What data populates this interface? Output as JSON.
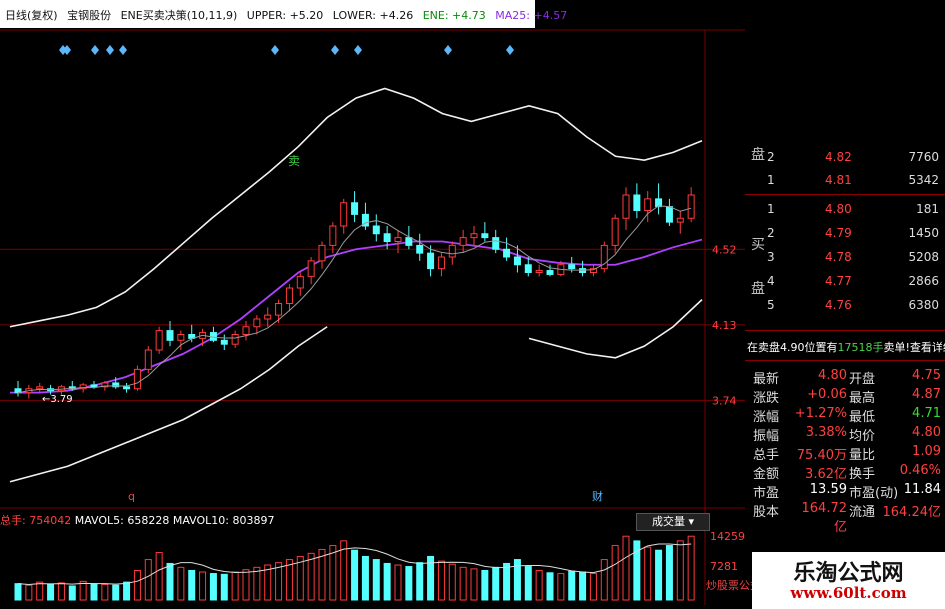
{
  "header": {
    "period": "日线(复权)",
    "stock_name": "宝钢股份",
    "indicator": "ENE买卖决策(10,11,9)",
    "upper": "UPPER: +5.20",
    "lower": "LOWER: +4.26",
    "ene": "ENE: +4.73",
    "ma25": "MA25: +4.57"
  },
  "colors": {
    "up": "#ff3a3a",
    "down": "#54ffff",
    "band": "#f2f2f2",
    "ma_short": "#ffffff",
    "ma_long": "#b040ff",
    "grid": "#7a0000",
    "sell_green": "#44cc44"
  },
  "chart_data": [
    {
      "type": "candlestick",
      "y_tick_labels": [
        "4.52",
        "4.13",
        "3.74"
      ],
      "ylim": [
        3.2,
        5.6
      ],
      "annotations": [
        "3.79",
        "卖",
        "q",
        "财"
      ],
      "signal_marker_positions": [
        63,
        67,
        95,
        110,
        123,
        275,
        335,
        358,
        448,
        510
      ],
      "series": [
        {
          "name": "UPPER",
          "values": [
            4.12,
            4.15,
            4.18,
            4.22,
            4.3,
            4.42,
            4.55,
            4.68,
            4.8,
            4.92,
            5.05,
            5.2,
            5.3,
            5.35,
            5.3,
            5.22,
            5.18,
            5.22,
            5.26,
            5.22,
            5.1,
            5.0,
            4.98,
            5.02,
            5.08
          ]
        },
        {
          "name": "LOWER",
          "values": [
            3.32,
            3.36,
            3.4,
            3.46,
            3.52,
            3.58,
            3.64,
            3.72,
            3.8,
            3.9,
            4.02,
            4.12,
            null,
            null,
            null,
            null,
            null,
            null,
            4.06,
            4.02,
            3.98,
            3.96,
            4.02,
            4.12,
            4.26
          ]
        },
        {
          "name": "MA25",
          "values": [
            3.78,
            3.78,
            3.79,
            3.82,
            3.86,
            3.92,
            3.98,
            4.06,
            4.16,
            4.28,
            4.4,
            4.48,
            4.52,
            4.54,
            4.56,
            4.56,
            4.54,
            4.52,
            4.47,
            4.45,
            4.44,
            4.44,
            4.48,
            4.53,
            4.57
          ]
        }
      ],
      "candles": [
        [
          3.8,
          3.84,
          3.76,
          3.78
        ],
        [
          3.78,
          3.82,
          3.75,
          3.8
        ],
        [
          3.8,
          3.83,
          3.78,
          3.81
        ],
        [
          3.8,
          3.82,
          3.77,
          3.79
        ],
        [
          3.79,
          3.82,
          3.77,
          3.81
        ],
        [
          3.81,
          3.84,
          3.79,
          3.8
        ],
        [
          3.8,
          3.83,
          3.78,
          3.82
        ],
        [
          3.82,
          3.84,
          3.8,
          3.81
        ],
        [
          3.81,
          3.84,
          3.79,
          3.83
        ],
        [
          3.83,
          3.86,
          3.8,
          3.81
        ],
        [
          3.81,
          3.83,
          3.78,
          3.8
        ],
        [
          3.8,
          3.92,
          3.79,
          3.9
        ],
        [
          3.9,
          4.02,
          3.88,
          4.0
        ],
        [
          4.0,
          4.12,
          3.98,
          4.1
        ],
        [
          4.1,
          4.15,
          4.02,
          4.05
        ],
        [
          4.05,
          4.1,
          4.0,
          4.08
        ],
        [
          4.08,
          4.13,
          4.04,
          4.06
        ],
        [
          4.06,
          4.11,
          4.02,
          4.09
        ],
        [
          4.09,
          4.12,
          4.04,
          4.05
        ],
        [
          4.05,
          4.08,
          4.0,
          4.03
        ],
        [
          4.03,
          4.1,
          4.01,
          4.08
        ],
        [
          4.08,
          4.15,
          4.05,
          4.12
        ],
        [
          4.12,
          4.18,
          4.08,
          4.16
        ],
        [
          4.16,
          4.22,
          4.12,
          4.18
        ],
        [
          4.18,
          4.26,
          4.14,
          4.24
        ],
        [
          4.24,
          4.34,
          4.2,
          4.32
        ],
        [
          4.32,
          4.4,
          4.28,
          4.38
        ],
        [
          4.38,
          4.48,
          4.34,
          4.46
        ],
        [
          4.46,
          4.56,
          4.42,
          4.54
        ],
        [
          4.54,
          4.66,
          4.5,
          4.64
        ],
        [
          4.64,
          4.78,
          4.6,
          4.76
        ],
        [
          4.76,
          4.82,
          4.66,
          4.7
        ],
        [
          4.7,
          4.76,
          4.62,
          4.64
        ],
        [
          4.64,
          4.7,
          4.56,
          4.6
        ],
        [
          4.6,
          4.64,
          4.52,
          4.56
        ],
        [
          4.56,
          4.62,
          4.5,
          4.58
        ],
        [
          4.58,
          4.64,
          4.52,
          4.54
        ],
        [
          4.54,
          4.6,
          4.46,
          4.5
        ],
        [
          4.5,
          4.54,
          4.38,
          4.42
        ],
        [
          4.42,
          4.5,
          4.38,
          4.48
        ],
        [
          4.48,
          4.56,
          4.44,
          4.54
        ],
        [
          4.54,
          4.62,
          4.5,
          4.58
        ],
        [
          4.58,
          4.64,
          4.54,
          4.6
        ],
        [
          4.6,
          4.66,
          4.56,
          4.58
        ],
        [
          4.58,
          4.62,
          4.5,
          4.52
        ],
        [
          4.52,
          4.58,
          4.46,
          4.48
        ],
        [
          4.48,
          4.54,
          4.4,
          4.44
        ],
        [
          4.44,
          4.48,
          4.38,
          4.4
        ],
        [
          4.4,
          4.44,
          4.38,
          4.41
        ],
        [
          4.41,
          4.44,
          4.38,
          4.39
        ],
        [
          4.39,
          4.46,
          4.38,
          4.44
        ],
        [
          4.44,
          4.48,
          4.4,
          4.42
        ],
        [
          4.42,
          4.46,
          4.38,
          4.4
        ],
        [
          4.4,
          4.44,
          4.38,
          4.42
        ],
        [
          4.42,
          4.56,
          4.4,
          4.54
        ],
        [
          4.54,
          4.7,
          4.5,
          4.68
        ],
        [
          4.68,
          4.84,
          4.62,
          4.8
        ],
        [
          4.8,
          4.86,
          4.68,
          4.72
        ],
        [
          4.72,
          4.82,
          4.66,
          4.78
        ],
        [
          4.78,
          4.86,
          4.7,
          4.74
        ],
        [
          4.74,
          4.78,
          4.64,
          4.66
        ],
        [
          4.66,
          4.72,
          4.6,
          4.68
        ],
        [
          4.68,
          4.84,
          4.66,
          4.8
        ]
      ]
    },
    {
      "type": "bar",
      "title": "总手",
      "values_label": "754042",
      "mavol5": "658228",
      "mavol10": "803897",
      "y_tick_labels": [
        "14259",
        "7281"
      ],
      "volumes": [
        210,
        190,
        230,
        200,
        220,
        180,
        240,
        210,
        200,
        190,
        230,
        380,
        520,
        610,
        470,
        420,
        380,
        360,
        340,
        330,
        360,
        390,
        420,
        450,
        480,
        520,
        560,
        600,
        650,
        700,
        760,
        640,
        560,
        520,
        470,
        450,
        430,
        480,
        560,
        500,
        460,
        420,
        400,
        380,
        420,
        470,
        520,
        430,
        380,
        350,
        340,
        370,
        360,
        340,
        520,
        700,
        820,
        760,
        680,
        640,
        700,
        760,
        820
      ]
    }
  ],
  "orderbook": {
    "sell_label": "卖盘",
    "buy_label": "买盘",
    "sell_rows": [
      {
        "level": "2",
        "price": "4.82",
        "volume": "7760"
      },
      {
        "level": "1",
        "price": "4.81",
        "volume": "5342"
      }
    ],
    "buy_rows": [
      {
        "level": "1",
        "price": "4.80",
        "volume": "181"
      },
      {
        "level": "2",
        "price": "4.79",
        "volume": "1450"
      },
      {
        "level": "3",
        "price": "4.78",
        "volume": "5208"
      },
      {
        "level": "4",
        "price": "4.77",
        "volume": "2866"
      },
      {
        "level": "5",
        "price": "4.76",
        "volume": "6380"
      }
    ]
  },
  "notice": {
    "text": "在卖盘4.90位置有",
    "amount": "17518手",
    "action": "卖单!查看详细"
  },
  "stats": [
    {
      "l1": "最新",
      "v1": "4.80",
      "l2": "开盘",
      "v2": "4.75",
      "c1": "red",
      "c2": "red"
    },
    {
      "l1": "涨跌",
      "v1": "+0.06",
      "l2": "最高",
      "v2": "4.87",
      "c1": "red",
      "c2": "red"
    },
    {
      "l1": "涨幅",
      "v1": "+1.27%",
      "l2": "最低",
      "v2": "4.71",
      "c1": "red",
      "c2": "green"
    },
    {
      "l1": "振幅",
      "v1": "3.38%",
      "l2": "均价",
      "v2": "4.80",
      "c1": "red",
      "c2": "red"
    },
    {
      "l1": "总手",
      "v1": "75.40万",
      "l2": "量比",
      "v2": "1.09",
      "c1": "red",
      "c2": "red"
    },
    {
      "l1": "金额",
      "v1": "3.62亿",
      "l2": "换手",
      "v2": "0.46%",
      "c1": "red",
      "c2": "red"
    },
    {
      "l1": "市盈",
      "v1": "13.59",
      "l2": "市盈(动)",
      "v2": "11.84",
      "c1": "white",
      "c2": "white"
    },
    {
      "l1": "股本",
      "v1": "164.72亿",
      "l2": "流通",
      "v2": "164.24亿",
      "c1": "red",
      "c2": "red"
    }
  ],
  "volume_select": "成交量",
  "source_text": "炒股票公式",
  "watermark": {
    "title": "乐淘公式网",
    "url": "www.60lt.com"
  }
}
